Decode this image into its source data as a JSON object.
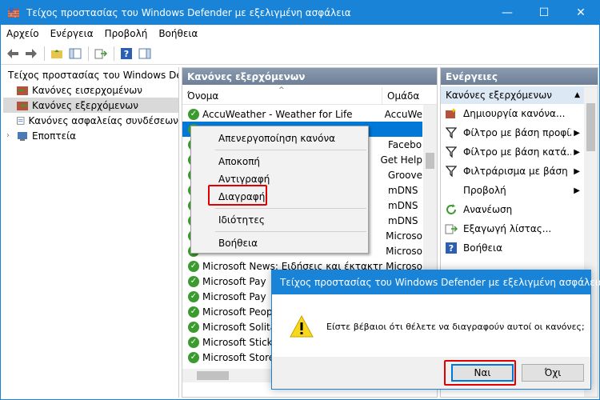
{
  "window": {
    "title": "Τείχος προστασίας του Windows Defender με εξελιγμένη ασφάλεια",
    "minimize": "—",
    "maximize": "☐",
    "close": "✕"
  },
  "menubar": [
    "Αρχείο",
    "Ενέργεια",
    "Προβολή",
    "Βοήθεια"
  ],
  "tree": {
    "root": "Τείχος προστασίας του Windows Defender",
    "items": [
      "Κανόνες εισερχομένων",
      "Κανόνες εξερχόμενων",
      "Κανόνες ασφαλείας συνδέσεων",
      "Εποπτεία"
    ],
    "selected": "Κανόνες εξερχόμενων"
  },
  "middle": {
    "header": "Κανόνες εξερχόμενων",
    "col_name": "Όνομα",
    "col_group": "Ομάδα",
    "rows": [
      {
        "name": "AccuWeather - Weather for Life",
        "group": "AccuWe"
      },
      {
        "name": "",
        "group": ""
      },
      {
        "name": "",
        "group": "Facebo"
      },
      {
        "name": "",
        "group": "Get Help"
      },
      {
        "name": "",
        "group": "Groove"
      },
      {
        "name": "",
        "group": "mDNS"
      },
      {
        "name": "",
        "group": "mDNS"
      },
      {
        "name": "",
        "group": "mDNS"
      },
      {
        "name": "",
        "group": "Microso"
      },
      {
        "name": "",
        "group": "Microso"
      },
      {
        "name": "Microsoft News: Ειδήσεις και έκτακτη επι...",
        "group": "Microso"
      },
      {
        "name": "Microsoft Pay",
        "group": ""
      },
      {
        "name": "Microsoft Pay",
        "group": ""
      },
      {
        "name": "Microsoft People",
        "group": ""
      },
      {
        "name": "Microsoft Solitaire",
        "group": ""
      },
      {
        "name": "Microsoft Sticky",
        "group": ""
      },
      {
        "name": "Microsoft Store",
        "group": ""
      }
    ]
  },
  "context_menu": {
    "items": [
      "Απενεργοποίηση κανόνα",
      "Αποκοπή",
      "Αντιγραφή",
      "Διαγραφή",
      "Ιδιότητες",
      "Βοήθεια"
    ]
  },
  "actions": {
    "header": "Ενέργειες",
    "section": "Κανόνες εξερχόμενων",
    "items": [
      {
        "label": "Δημιουργία κανόνα...",
        "icon": "new-rule-icon"
      },
      {
        "label": "Φίλτρο με βάση προφίλ",
        "icon": "filter-icon"
      },
      {
        "label": "Φίλτρο με βάση κατά...",
        "icon": "filter-icon"
      },
      {
        "label": "Φιλτράρισμα με βάση ...",
        "icon": "filter-icon"
      },
      {
        "label": "Προβολή",
        "icon": ""
      },
      {
        "label": "Ανανέωση",
        "icon": "refresh-icon"
      },
      {
        "label": "Εξαγωγή λίστας...",
        "icon": "export-icon"
      },
      {
        "label": "Βοήθεια",
        "icon": "help-icon"
      }
    ]
  },
  "dialog": {
    "title": "Τείχος προστασίας του Windows Defender με εξελιγμένη ασφάλεια",
    "message": "Είστε βέβαιοι ότι θέλετε να διαγραφούν αυτοί οι κανόνες;",
    "yes": "Ναι",
    "no": "Όχι"
  },
  "colors": {
    "titlebar": "#1883d7",
    "highlight": "#e00000",
    "selection": "#0078d7"
  }
}
